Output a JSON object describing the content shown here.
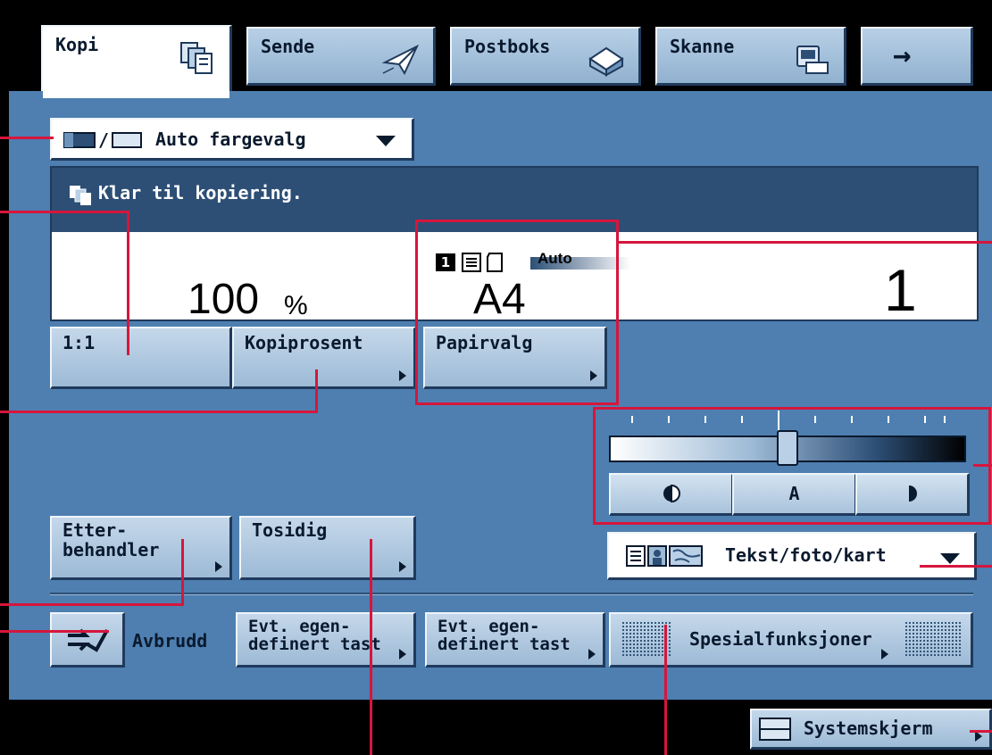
{
  "tabs": [
    {
      "label": "Kopi",
      "icon": "copy-icon",
      "active": true
    },
    {
      "label": "Sende",
      "icon": "paper-plane-icon"
    },
    {
      "label": "Postboks",
      "icon": "mailbox-icon"
    },
    {
      "label": "Skanne",
      "icon": "scanner-icon"
    },
    {
      "label": "→",
      "icon": "arrow-right-icon"
    }
  ],
  "color_select": {
    "value": "Auto fargevalg",
    "icon": "color-mode-icon"
  },
  "status": {
    "message": "Klar til kopiering."
  },
  "display": {
    "ratio_value": "100",
    "ratio_unit": "%",
    "paper_mode": "Auto",
    "paper_size": "A4",
    "paper_tray": "1",
    "copies": "1"
  },
  "buttons": {
    "one_to_one": "1:1",
    "copy_ratio": "Kopiprosent",
    "paper_select": "Papirvalg",
    "finisher_line1": "Etter-",
    "finisher_line2": "behandler",
    "two_sided": "Tosidig",
    "interrupt": "Avbrudd",
    "custom1_line1": "Evt. egen-",
    "custom1_line2": "definert tast",
    "custom2_line1": "Evt. egen-",
    "custom2_line2": "definert tast",
    "special": "Spesialfunksjoner",
    "system_monitor": "Systemskjerm"
  },
  "density": {
    "auto_label": "A",
    "level": 0.5
  },
  "image_mode": {
    "value": "Tekst/foto/kart"
  },
  "colors": {
    "panel": "#4e7fb0",
    "status_bar": "#2d4f76",
    "callout": "#d6163c"
  }
}
